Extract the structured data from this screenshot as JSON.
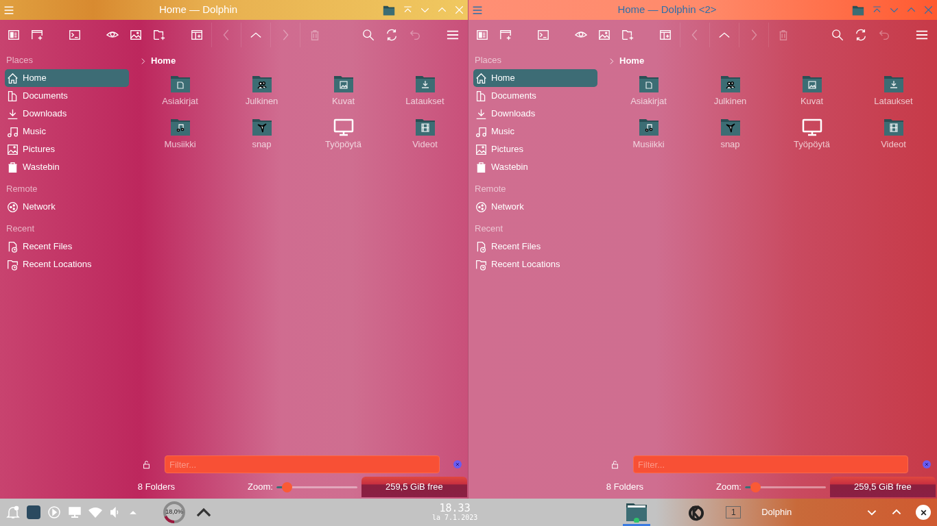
{
  "windows": [
    {
      "title": "Home — Dolphin",
      "active": true,
      "toolbar": [
        {
          "kind": "view",
          "disabled": false
        },
        {
          "kind": "new-window",
          "disabled": false
        },
        {
          "kind": "terminal",
          "disabled": false
        },
        {
          "kind": "preview",
          "disabled": false
        },
        {
          "kind": "image",
          "disabled": false
        },
        {
          "kind": "new-folder",
          "disabled": false
        },
        {
          "kind": "split",
          "disabled": false
        },
        {
          "kind": "back",
          "disabled": true
        },
        {
          "kind": "up",
          "disabled": false
        },
        {
          "kind": "forward",
          "disabled": true
        },
        {
          "kind": "delete",
          "disabled": true
        },
        {
          "kind": "search",
          "disabled": false
        },
        {
          "kind": "reload",
          "disabled": false
        },
        {
          "kind": "undo",
          "disabled": true
        },
        {
          "kind": "menu",
          "disabled": false
        }
      ],
      "places": [
        {
          "heading": "Places",
          "items": [
            {
              "label": "Home",
              "kind": "home",
              "selected": true
            },
            {
              "label": "Documents",
              "kind": "documents",
              "selected": false
            },
            {
              "label": "Downloads",
              "kind": "downloads",
              "selected": false
            },
            {
              "label": "Music",
              "kind": "music",
              "selected": false
            },
            {
              "label": "Pictures",
              "kind": "pictures",
              "selected": false
            },
            {
              "label": "Wastebin",
              "kind": "trash",
              "selected": false
            }
          ]
        },
        {
          "heading": "Remote",
          "items": [
            {
              "label": "Network",
              "kind": "network",
              "selected": false
            }
          ]
        },
        {
          "heading": "Recent",
          "items": [
            {
              "label": "Recent Files",
              "kind": "recent-files",
              "selected": false
            },
            {
              "label": "Recent Locations",
              "kind": "recent-locations",
              "selected": false
            }
          ]
        }
      ],
      "breadcrumb": "Home",
      "folders": [
        {
          "name": "Asiakirjat",
          "kind": "documents"
        },
        {
          "name": "Julkinen",
          "kind": "public"
        },
        {
          "name": "Kuvat",
          "kind": "pictures"
        },
        {
          "name": "Lataukset",
          "kind": "downloads"
        },
        {
          "name": "Musiikki",
          "kind": "music"
        },
        {
          "name": "snap",
          "kind": "snap"
        },
        {
          "name": "Työpöytä",
          "kind": "desktop"
        },
        {
          "name": "Videot",
          "kind": "videos"
        }
      ],
      "filter": {
        "placeholder": "Filter..."
      },
      "status": {
        "count": "8 Folders",
        "zoom_label": "Zoom:",
        "zoom": {
          "level": 0.13
        },
        "free_space": "259,5 GiB free"
      }
    },
    {
      "title": "Home — Dolphin <2>",
      "active": false,
      "toolbar": [
        {
          "kind": "view",
          "disabled": false
        },
        {
          "kind": "new-window",
          "disabled": false
        },
        {
          "kind": "terminal",
          "disabled": false
        },
        {
          "kind": "preview",
          "disabled": false
        },
        {
          "kind": "image",
          "disabled": false
        },
        {
          "kind": "new-folder",
          "disabled": false
        },
        {
          "kind": "split",
          "disabled": false
        },
        {
          "kind": "back",
          "disabled": true
        },
        {
          "kind": "up",
          "disabled": false
        },
        {
          "kind": "forward",
          "disabled": true
        },
        {
          "kind": "delete",
          "disabled": true
        },
        {
          "kind": "search",
          "disabled": false
        },
        {
          "kind": "reload",
          "disabled": false
        },
        {
          "kind": "undo",
          "disabled": true
        },
        {
          "kind": "menu",
          "disabled": false
        }
      ],
      "places": [
        {
          "heading": "Places",
          "items": [
            {
              "label": "Home",
              "kind": "home",
              "selected": true
            },
            {
              "label": "Documents",
              "kind": "documents",
              "selected": false
            },
            {
              "label": "Downloads",
              "kind": "downloads",
              "selected": false
            },
            {
              "label": "Music",
              "kind": "music",
              "selected": false
            },
            {
              "label": "Pictures",
              "kind": "pictures",
              "selected": false
            },
            {
              "label": "Wastebin",
              "kind": "trash",
              "selected": false
            }
          ]
        },
        {
          "heading": "Remote",
          "items": [
            {
              "label": "Network",
              "kind": "network",
              "selected": false
            }
          ]
        },
        {
          "heading": "Recent",
          "items": [
            {
              "label": "Recent Files",
              "kind": "recent-files",
              "selected": false
            },
            {
              "label": "Recent Locations",
              "kind": "recent-locations",
              "selected": false
            }
          ]
        }
      ],
      "breadcrumb": "Home",
      "folders": [
        {
          "name": "Asiakirjat",
          "kind": "documents"
        },
        {
          "name": "Julkinen",
          "kind": "public"
        },
        {
          "name": "Kuvat",
          "kind": "pictures"
        },
        {
          "name": "Lataukset",
          "kind": "downloads"
        },
        {
          "name": "Musiikki",
          "kind": "music"
        },
        {
          "name": "snap",
          "kind": "snap"
        },
        {
          "name": "Työpöytä",
          "kind": "desktop"
        },
        {
          "name": "Videot",
          "kind": "videos"
        }
      ],
      "filter": {
        "placeholder": "Filter..."
      },
      "status": {
        "count": "8 Folders",
        "zoom_label": "Zoom:",
        "zoom": {
          "level": 0.13
        },
        "free_space": "259,5 GiB free"
      }
    }
  ],
  "taskbar": {
    "cpu": {
      "reading": "18,0%",
      "level": 0.18
    },
    "clock": {
      "time": "18.33",
      "date": "la 7.1.2023"
    },
    "pager": "1",
    "task": "Dolphin"
  }
}
